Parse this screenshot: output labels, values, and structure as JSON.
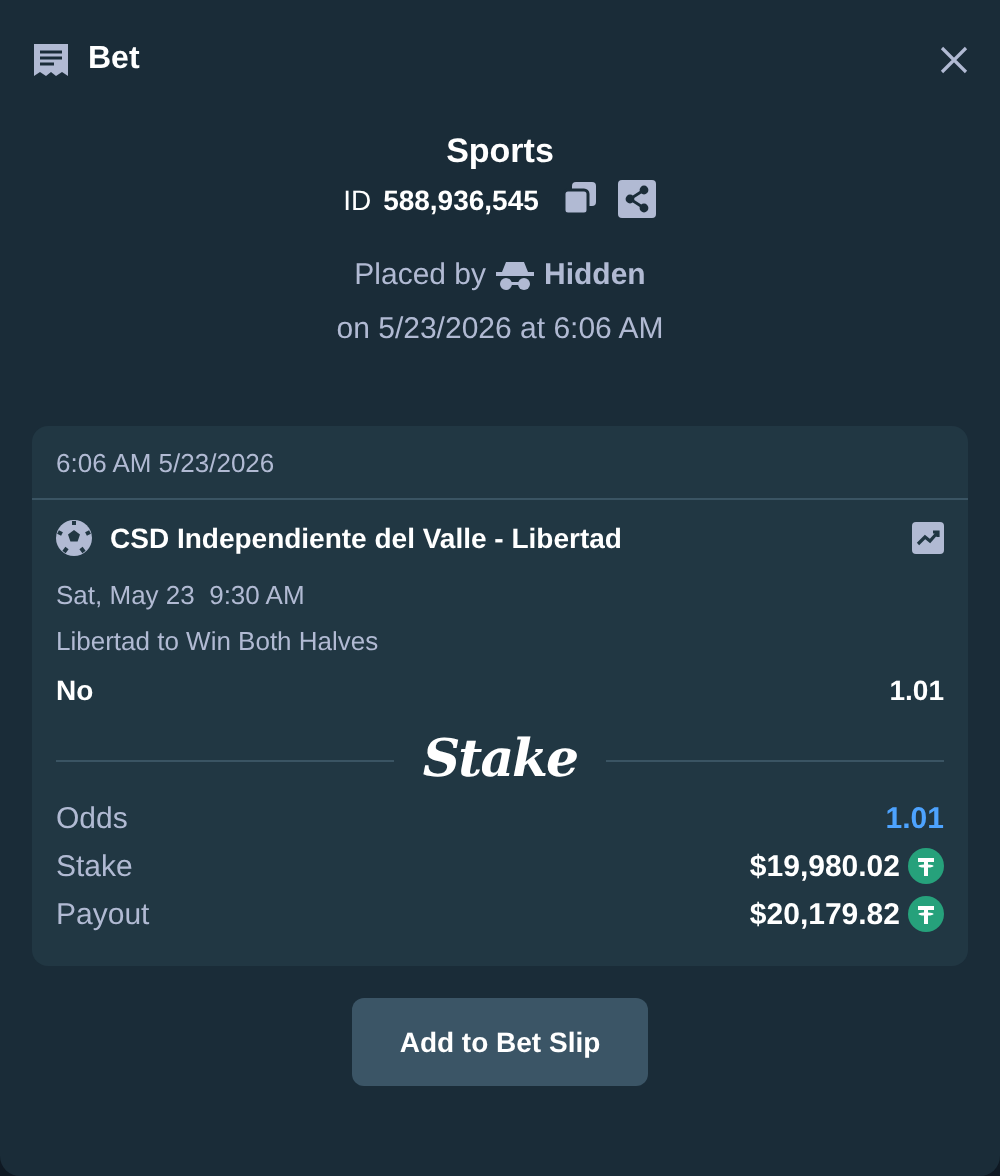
{
  "header": {
    "title": "Bet"
  },
  "summary": {
    "category": "Sports",
    "id_label": "ID",
    "id_value": "588,936,545",
    "placed_by_label": "Placed by",
    "placed_by_user": "Hidden",
    "placed_on": "on 5/23/2026 at 6:06 AM"
  },
  "card": {
    "timestamp": "6:06 AM 5/23/2026",
    "event": "CSD Independiente del Valle - Libertad",
    "start_time": "Sat, May 23  9:30 AM",
    "market": "Libertad to Win Both Halves",
    "selection": "No",
    "selection_odds": "1.01",
    "logo": "Stake",
    "totals": [
      {
        "kind": "odds",
        "label": "Odds",
        "value": "1.01"
      },
      {
        "kind": "amount",
        "label": "Stake",
        "value": "$19,980.02"
      },
      {
        "kind": "amount",
        "label": "Payout",
        "value": "$20,179.82"
      }
    ]
  },
  "button": "Add to Bet Slip"
}
